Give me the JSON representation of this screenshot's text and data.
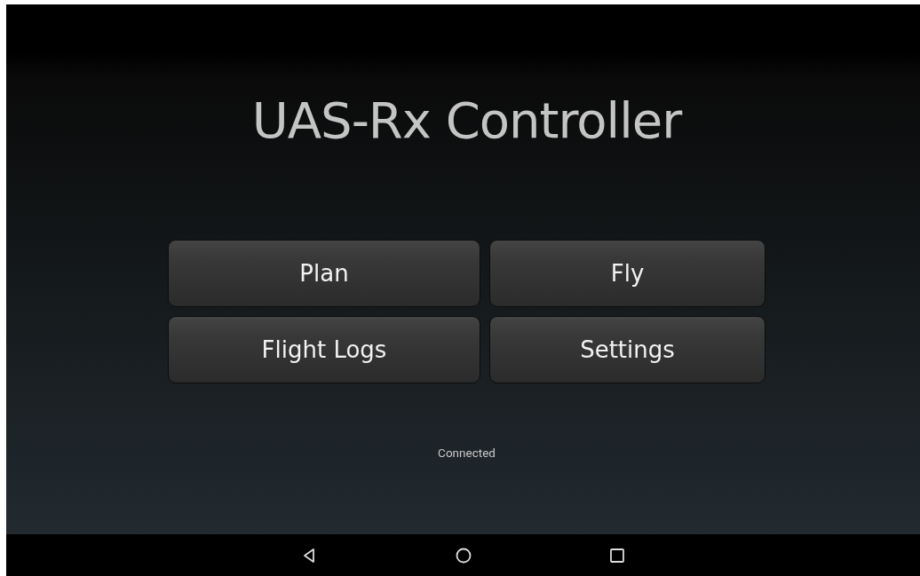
{
  "title": "UAS-Rx Controller",
  "buttons": [
    {
      "label": "Plan"
    },
    {
      "label": "Fly"
    },
    {
      "label": "Flight Logs"
    },
    {
      "label": "Settings"
    }
  ],
  "status": "Connected",
  "nav_bar": {
    "buttons": [
      {
        "kind": "back"
      },
      {
        "kind": "home"
      },
      {
        "kind": "recents"
      }
    ]
  }
}
